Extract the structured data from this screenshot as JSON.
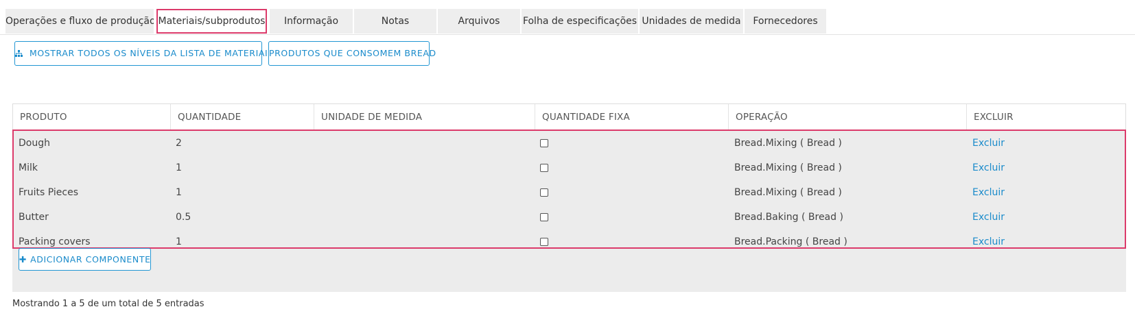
{
  "tabs": [
    {
      "label": "Operações e fluxo de produção",
      "active": false
    },
    {
      "label": "Materiais/subprodutos",
      "active": true
    },
    {
      "label": "Informação",
      "active": false
    },
    {
      "label": "Notas",
      "active": false
    },
    {
      "label": "Arquivos",
      "active": false
    },
    {
      "label": "Folha de especificações",
      "active": false
    },
    {
      "label": "Unidades de medida",
      "active": false
    },
    {
      "label": "Fornecedores",
      "active": false
    }
  ],
  "actions": {
    "show_levels_label": "MOSTRAR TODOS OS NÍVEIS DA LISTA DE MATERIAIS",
    "show_levels_icon": "sitemap-icon",
    "consumers_label": "PRODUTOS QUE CONSOMEM BREAD"
  },
  "table": {
    "headers": [
      "PRODUTO",
      "QUANTIDADE",
      "UNIDADE DE MEDIDA",
      "QUANTIDADE FIXA",
      "OPERAÇÃO",
      "EXCLUIR"
    ],
    "rows": [
      {
        "product": "Dough",
        "quantity": "2",
        "unit": "",
        "fixed": false,
        "operation": "Bread.Mixing ( Bread )",
        "delete": "Excluir"
      },
      {
        "product": "Milk",
        "quantity": "1",
        "unit": "",
        "fixed": false,
        "operation": "Bread.Mixing ( Bread )",
        "delete": "Excluir"
      },
      {
        "product": "Fruits Pieces",
        "quantity": "1",
        "unit": "",
        "fixed": false,
        "operation": "Bread.Mixing ( Bread )",
        "delete": "Excluir"
      },
      {
        "product": "Butter",
        "quantity": "0.5",
        "unit": "",
        "fixed": false,
        "operation": "Bread.Baking ( Bread )",
        "delete": "Excluir"
      },
      {
        "product": "Packing covers",
        "quantity": "1",
        "unit": "",
        "fixed": false,
        "operation": "Bread.Packing ( Bread )",
        "delete": "Excluir"
      }
    ],
    "add_label": "ADICIONAR COMPONENTE",
    "add_icon": "plus-icon"
  },
  "footer": {
    "summary": "Mostrando 1 a 5 de um total de 5 entradas"
  },
  "colors": {
    "accent": "#2196d3",
    "highlight": "#dc3a6a",
    "link": "#1a8bcb"
  }
}
